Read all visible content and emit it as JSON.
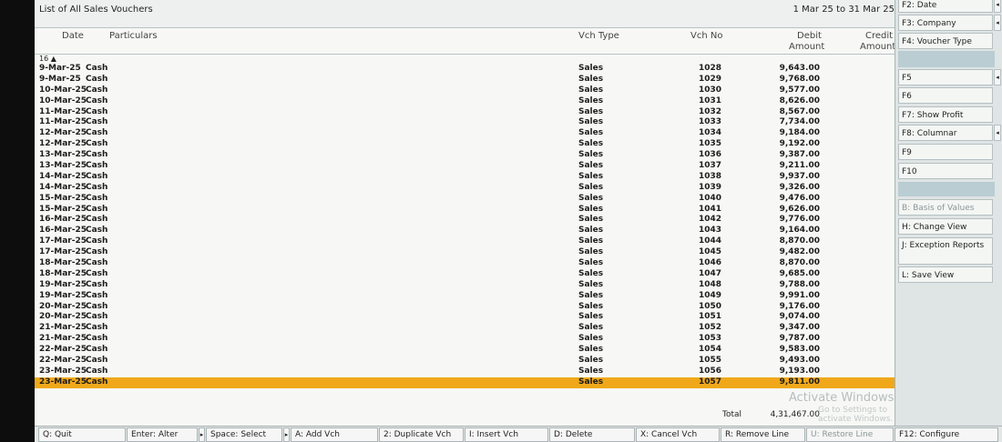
{
  "header": {
    "title": "List of All Sales Vouchers",
    "period": "1 Mar 25 to 31 Mar 25"
  },
  "columns": {
    "date": "Date",
    "particulars": "Particulars",
    "vch_type": "Vch Type",
    "vch_no": "Vch No",
    "debit_line1": "Debit",
    "debit_line2": "Amount",
    "credit_line1": "Credit",
    "credit_line2": "Amount"
  },
  "group_label": "16 ▲",
  "rows": [
    {
      "date": "9-Mar-25",
      "particulars": "Cash",
      "type": "Sales",
      "no": "1028",
      "debit": "9,643.00"
    },
    {
      "date": "9-Mar-25",
      "particulars": "Cash",
      "type": "Sales",
      "no": "1029",
      "debit": "9,768.00"
    },
    {
      "date": "10-Mar-25",
      "particulars": "Cash",
      "type": "Sales",
      "no": "1030",
      "debit": "9,577.00"
    },
    {
      "date": "10-Mar-25",
      "particulars": "Cash",
      "type": "Sales",
      "no": "1031",
      "debit": "8,626.00"
    },
    {
      "date": "11-Mar-25",
      "particulars": "Cash",
      "type": "Sales",
      "no": "1032",
      "debit": "8,567.00"
    },
    {
      "date": "11-Mar-25",
      "particulars": "Cash",
      "type": "Sales",
      "no": "1033",
      "debit": "7,734.00"
    },
    {
      "date": "12-Mar-25",
      "particulars": "Cash",
      "type": "Sales",
      "no": "1034",
      "debit": "9,184.00"
    },
    {
      "date": "12-Mar-25",
      "particulars": "Cash",
      "type": "Sales",
      "no": "1035",
      "debit": "9,192.00"
    },
    {
      "date": "13-Mar-25",
      "particulars": "Cash",
      "type": "Sales",
      "no": "1036",
      "debit": "9,387.00"
    },
    {
      "date": "13-Mar-25",
      "particulars": "Cash",
      "type": "Sales",
      "no": "1037",
      "debit": "9,211.00"
    },
    {
      "date": "14-Mar-25",
      "particulars": "Cash",
      "type": "Sales",
      "no": "1038",
      "debit": "9,937.00"
    },
    {
      "date": "14-Mar-25",
      "particulars": "Cash",
      "type": "Sales",
      "no": "1039",
      "debit": "9,326.00"
    },
    {
      "date": "15-Mar-25",
      "particulars": "Cash",
      "type": "Sales",
      "no": "1040",
      "debit": "9,476.00"
    },
    {
      "date": "15-Mar-25",
      "particulars": "Cash",
      "type": "Sales",
      "no": "1041",
      "debit": "9,626.00"
    },
    {
      "date": "16-Mar-25",
      "particulars": "Cash",
      "type": "Sales",
      "no": "1042",
      "debit": "9,776.00"
    },
    {
      "date": "16-Mar-25",
      "particulars": "Cash",
      "type": "Sales",
      "no": "1043",
      "debit": "9,164.00"
    },
    {
      "date": "17-Mar-25",
      "particulars": "Cash",
      "type": "Sales",
      "no": "1044",
      "debit": "8,870.00"
    },
    {
      "date": "17-Mar-25",
      "particulars": "Cash",
      "type": "Sales",
      "no": "1045",
      "debit": "9,482.00"
    },
    {
      "date": "18-Mar-25",
      "particulars": "Cash",
      "type": "Sales",
      "no": "1046",
      "debit": "8,870.00"
    },
    {
      "date": "18-Mar-25",
      "particulars": "Cash",
      "type": "Sales",
      "no": "1047",
      "debit": "9,685.00"
    },
    {
      "date": "19-Mar-25",
      "particulars": "Cash",
      "type": "Sales",
      "no": "1048",
      "debit": "9,788.00"
    },
    {
      "date": "19-Mar-25",
      "particulars": "Cash",
      "type": "Sales",
      "no": "1049",
      "debit": "9,991.00"
    },
    {
      "date": "20-Mar-25",
      "particulars": "Cash",
      "type": "Sales",
      "no": "1050",
      "debit": "9,176.00"
    },
    {
      "date": "20-Mar-25",
      "particulars": "Cash",
      "type": "Sales",
      "no": "1051",
      "debit": "9,074.00"
    },
    {
      "date": "21-Mar-25",
      "particulars": "Cash",
      "type": "Sales",
      "no": "1052",
      "debit": "9,347.00"
    },
    {
      "date": "21-Mar-25",
      "particulars": "Cash",
      "type": "Sales",
      "no": "1053",
      "debit": "9,787.00"
    },
    {
      "date": "22-Mar-25",
      "particulars": "Cash",
      "type": "Sales",
      "no": "1054",
      "debit": "9,583.00"
    },
    {
      "date": "22-Mar-25",
      "particulars": "Cash",
      "type": "Sales",
      "no": "1055",
      "debit": "9,493.00"
    },
    {
      "date": "23-Mar-25",
      "particulars": "Cash",
      "type": "Sales",
      "no": "1056",
      "debit": "9,193.00"
    },
    {
      "date": "23-Mar-25",
      "particulars": "Cash",
      "type": "Sales",
      "no": "1057",
      "debit": "9,811.00",
      "selected": true
    }
  ],
  "total": {
    "label": "Total",
    "value": "4,31,467.00"
  },
  "watermark": {
    "line1": "Activate Windows",
    "line2": "Go to Settings to activate Windows."
  },
  "sidebar": {
    "f2": "F2: Date",
    "f3": "F3: Company",
    "f4": "F4: Voucher Type",
    "f5": "F5",
    "f6": "F6",
    "f7": "F7: Show Profit",
    "f8": "F8: Columnar",
    "f9": "F9",
    "f10": "F10",
    "basis": "B: Basis of Values",
    "change_view": "H: Change View",
    "exception": "J: Exception Reports",
    "save_view": "L: Save View"
  },
  "bottom": {
    "quit": "Q: Quit",
    "alter": "Enter: Alter",
    "select": "Space: Select",
    "add": "A: Add Vch",
    "duplicate": "2: Duplicate Vch",
    "insert": "I: Insert Vch",
    "delete": "D: Delete",
    "cancel": "X: Cancel Vch",
    "remove_line": "R: Remove Line",
    "restore_line": "U: Restore Line",
    "configure": "F12: Configure"
  },
  "colors": {
    "selected_row": "#f0a81a",
    "panel_bg": "#f7f8f6",
    "sidebar_bg": "#dfe4e4",
    "accent_gap": "#b9cdd3"
  }
}
